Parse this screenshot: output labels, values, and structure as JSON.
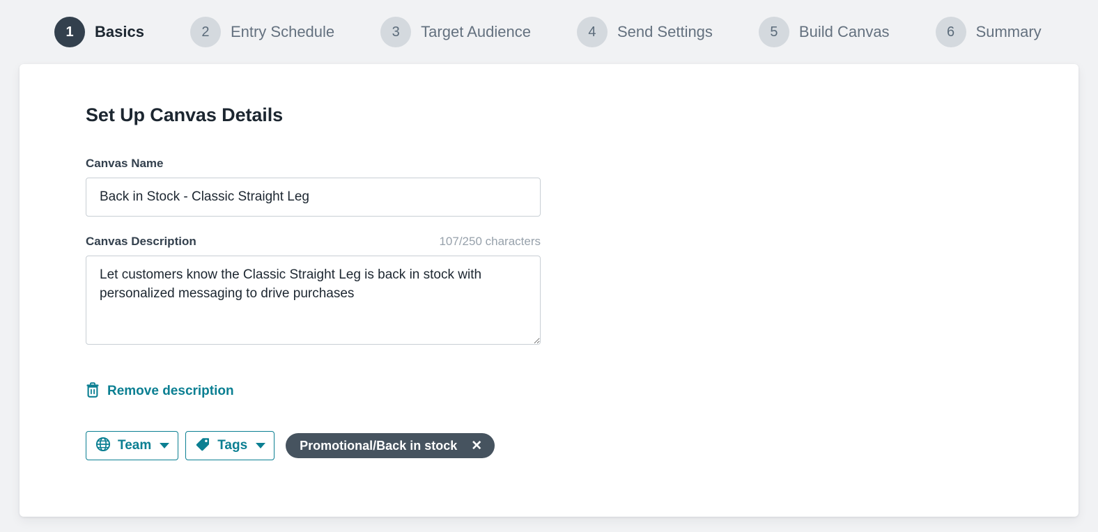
{
  "stepper": {
    "steps": [
      {
        "number": "1",
        "label": "Basics",
        "active": true
      },
      {
        "number": "2",
        "label": "Entry Schedule",
        "active": false
      },
      {
        "number": "3",
        "label": "Target Audience",
        "active": false
      },
      {
        "number": "4",
        "label": "Send Settings",
        "active": false
      },
      {
        "number": "5",
        "label": "Build Canvas",
        "active": false
      },
      {
        "number": "6",
        "label": "Summary",
        "active": false
      }
    ]
  },
  "main": {
    "title": "Set Up Canvas Details",
    "canvas_name": {
      "label": "Canvas Name",
      "value": "Back in Stock - Classic Straight Leg",
      "placeholder": "Canvas Name"
    },
    "canvas_description": {
      "label": "Canvas Description",
      "counter": "107/250 characters",
      "value": "Let customers know the Classic Straight Leg is back in stock with personalized messaging to drive purchases",
      "placeholder": "Canvas Description"
    },
    "remove_description": {
      "label": "Remove description",
      "icon": "trash-icon"
    },
    "controls": {
      "team": {
        "label": "Team",
        "icon": "globe-icon",
        "caret": "chevron-down-icon"
      },
      "tags": {
        "label": "Tags",
        "icon": "tag-icon",
        "caret": "chevron-down-icon"
      },
      "chips": [
        {
          "label": "Promotional/Back in stock",
          "close": "✕"
        }
      ]
    }
  },
  "colors": {
    "page_background": "#f1f2f4",
    "card_background": "#ffffff",
    "accent_teal": "#0b7f92",
    "active_step": "#33404d",
    "inactive_step": "#d4d9de",
    "chip_background": "#46535f",
    "text_dark": "#1c2630",
    "text_muted": "#97a1ab",
    "border": "#c8ced4"
  }
}
